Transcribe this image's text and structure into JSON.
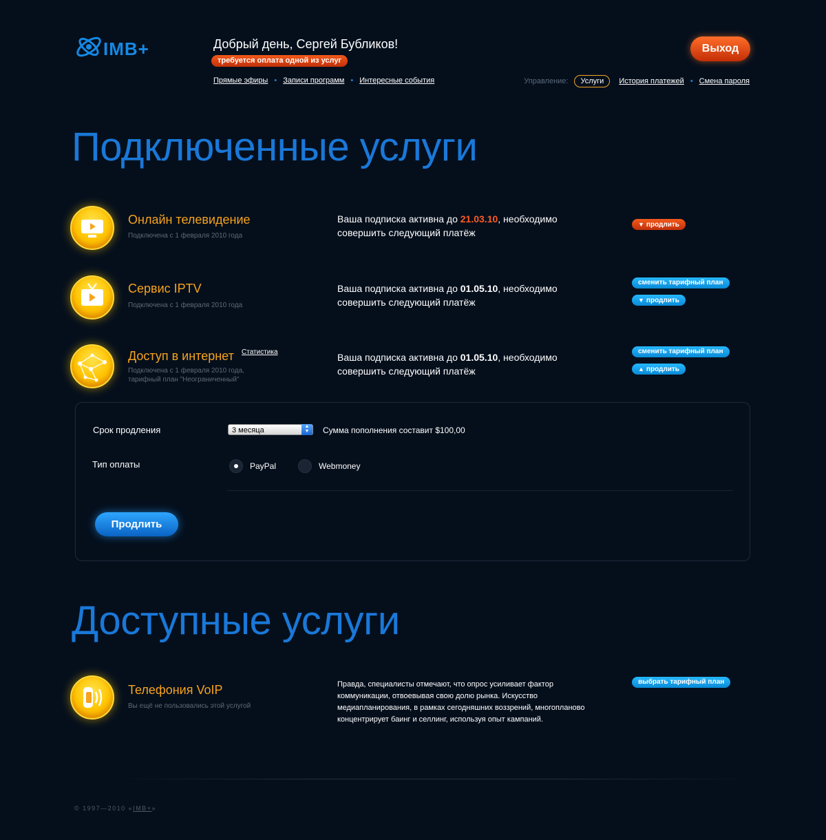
{
  "header": {
    "logo_text": "IMB+",
    "greeting": "Добрый день, Сергей Бубликов!",
    "payment_badge": "требуется оплата одной из услуг",
    "logout_label": "Выход",
    "nav_left": [
      "Прямые эфиры",
      "Записи программ",
      "Интересные события"
    ],
    "nav_right_caption": "Управление:",
    "nav_right": [
      "Услуги",
      "История платежей",
      "Смена пароля"
    ]
  },
  "connected": {
    "heading": "Подключенные услуги",
    "services": [
      {
        "title": "Онлайн телевидение",
        "subtitle": "Подключена с 1 февраля 2010 года",
        "desc_before": "Ваша подписка активна до ",
        "date": "21.03.10",
        "desc_after": ", необходимо совершить следующий платёж",
        "buttons": [
          "продлить"
        ]
      },
      {
        "title": "Сервис IPTV",
        "subtitle": "Подключена с 1 февраля 2010 года",
        "desc_before": "Ваша подписка активна до ",
        "date": "01.05.10",
        "desc_after": ", необходимо совершить следующий платёж",
        "buttons": [
          "сменить тарифный план",
          "продлить"
        ]
      },
      {
        "title": "Доступ в интернет",
        "stats_link": "Статистика",
        "subtitle": "Подключена с 1 февраля 2010 года, тарифный план \"Неограниченный\"",
        "desc_before": "Ваша подписка активна до ",
        "date": "01.05.10",
        "desc_after": ", необходимо совершить следующий платёж",
        "buttons": [
          "сменить тарифный план",
          "продлить"
        ]
      }
    ]
  },
  "extend_form": {
    "period_label": "Срок продления",
    "period_value": "3 месяца",
    "sum_text": "Сумма пополнения составит $100,00",
    "payment_label": "Тип оплаты",
    "payment_options": [
      "PayPal",
      "Webmoney"
    ],
    "payment_selected": "PayPal",
    "submit_label": "Продлить"
  },
  "available": {
    "heading": "Доступные услуги",
    "services": [
      {
        "title": "Телефония VoIP",
        "subtitle": "Вы ещё не пользовались этой услугой",
        "description": "Правда, специалисты отмечают, что опрос усиливает фактор коммуникации, отвоевывая свою долю рынка. Искусство медиапланирования, в рамках сегодняшних воззрений, многопланово концентрирует баинг и селлинг, используя опыт кампаний.",
        "button": "выбрать тарифный план"
      }
    ]
  },
  "footer": {
    "copyright": "© 1997—2010 «",
    "brand": "IMB+",
    "close": "»"
  },
  "colors": {
    "background": "#050f1c",
    "accent_blue": "#1a78d8",
    "accent_orange": "#f6a31d",
    "alert_red": "#e2461a",
    "button_cyan": "#18a8f4"
  }
}
